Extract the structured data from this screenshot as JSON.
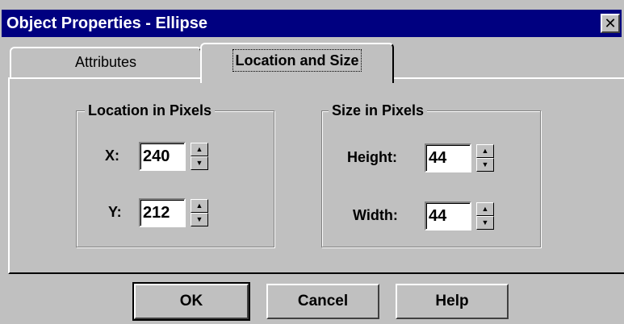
{
  "window": {
    "title": "Object Properties - Ellipse",
    "close_symbol": "✕"
  },
  "tabs": [
    {
      "label": "Attributes",
      "selected": false
    },
    {
      "label": "Location and Size",
      "selected": true
    }
  ],
  "location_group": {
    "title": "Location in Pixels",
    "x_label": "X:",
    "x_value": "240",
    "y_label": "Y:",
    "y_value": "212"
  },
  "size_group": {
    "title": "Size in Pixels",
    "height_label": "Height:",
    "height_value": "44",
    "width_label": "Width:",
    "width_value": "44"
  },
  "spinner": {
    "up_symbol": "▲",
    "down_symbol": "▼"
  },
  "buttons": {
    "ok": "OK",
    "cancel": "Cancel",
    "help": "Help"
  },
  "colors": {
    "titlebar": "#000080",
    "face": "#c0c0c0"
  }
}
